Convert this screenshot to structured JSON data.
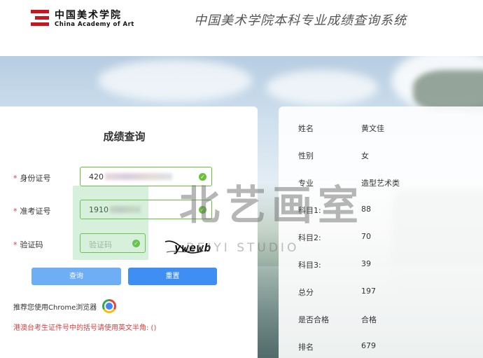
{
  "header": {
    "logo_cn": "中国美术学院",
    "logo_en": "China Academy of Art",
    "site_title": "中国美术学院本科专业成绩查询系统"
  },
  "form": {
    "title": "成绩查询",
    "id_label": "身份证号",
    "id_value": "420",
    "exam_label": "准考证号",
    "exam_value": "1910",
    "captcha_label": "验证码",
    "captcha_placeholder": "验证码",
    "captcha_text": "ywewb",
    "query_button": "查询",
    "reset_button": "重置",
    "browser_tip": "推荐您使用Chrome浏览器",
    "warning": "港澳台考生证件号中的括号请使用英文半角: ()"
  },
  "result": {
    "rows": [
      {
        "label": "姓名",
        "value": "黄文佳"
      },
      {
        "label": "性别",
        "value": "女"
      },
      {
        "label": "专业",
        "value": "造型艺术类"
      },
      {
        "label": "科目1:",
        "value": "88"
      },
      {
        "label": "科目2:",
        "value": "70"
      },
      {
        "label": "科目3:",
        "value": "39"
      },
      {
        "label": "总分",
        "value": "197"
      },
      {
        "label": "是否合格",
        "value": "合格"
      },
      {
        "label": "排名",
        "value": "679"
      }
    ]
  },
  "watermark": {
    "big": "北艺画室",
    "small": "BEIYI STUDIO"
  },
  "colors": {
    "brand_red": "#c8161d",
    "valid_green": "#67c23a",
    "button_light": "#6eaef4",
    "button_primary": "#3e8ef3",
    "warning_red": "#e23c3c"
  }
}
